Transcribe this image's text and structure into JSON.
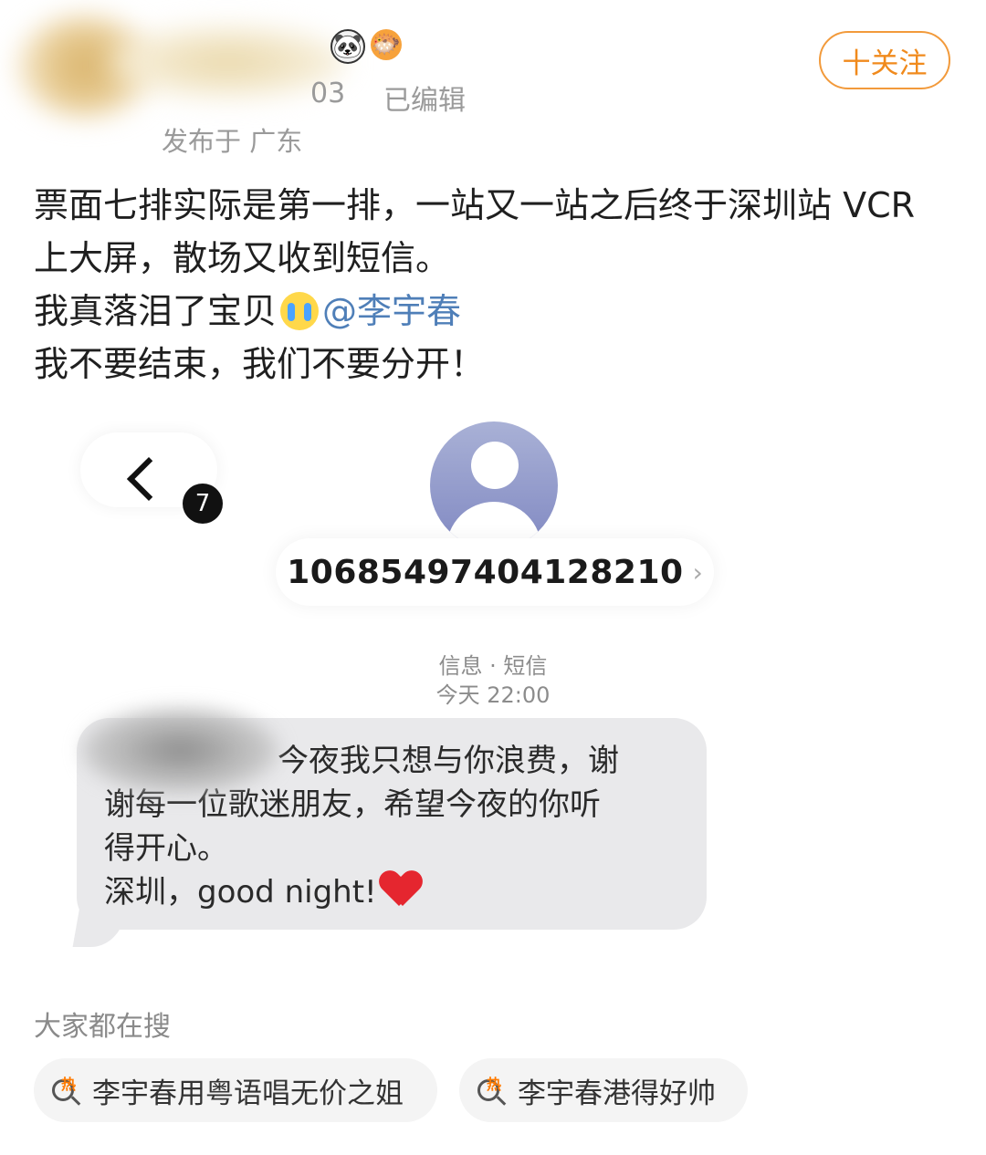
{
  "header": {
    "timestamp_partial": "03",
    "edited_label": "已编辑",
    "location": "发布于 广东",
    "badges": [
      "panda-emoji",
      "fish-emoji"
    ],
    "follow_label": "十关注"
  },
  "post": {
    "line1": "票面七排实际是第一排，一站又一站之后终于深圳站 VCR",
    "line2": "上大屏，散场又收到短信。",
    "line3_prefix": "我真落泪了宝贝",
    "line3_emoji": "crying-face",
    "mention": "@李宇春",
    "line4": "我不要结束，我们不要分开！"
  },
  "sms": {
    "unread_count": "7",
    "contact_number": "10685497404128210",
    "number_chevron": "›",
    "meta_type": "信息 · 短信",
    "meta_time": "今天 22:00",
    "message_line1": "今夜我只想与你浪费，谢",
    "message_line2": "谢每一位歌迷朋友，希望今夜的你听",
    "message_line3": "得开心。",
    "message_line4": "深圳，good night!",
    "message_emoji": "red-heart"
  },
  "search": {
    "heading": "大家都在搜",
    "chips": [
      {
        "label": "李宇春用粤语唱无价之姐",
        "badge": "热"
      },
      {
        "label": "李宇春港得好帅",
        "badge": "热"
      }
    ]
  },
  "colors": {
    "accent_orange": "#f08a1c",
    "mention_blue": "#4f7fb8",
    "bubble_gray": "#e9e9eb",
    "muted_text": "#9a9a9a"
  }
}
